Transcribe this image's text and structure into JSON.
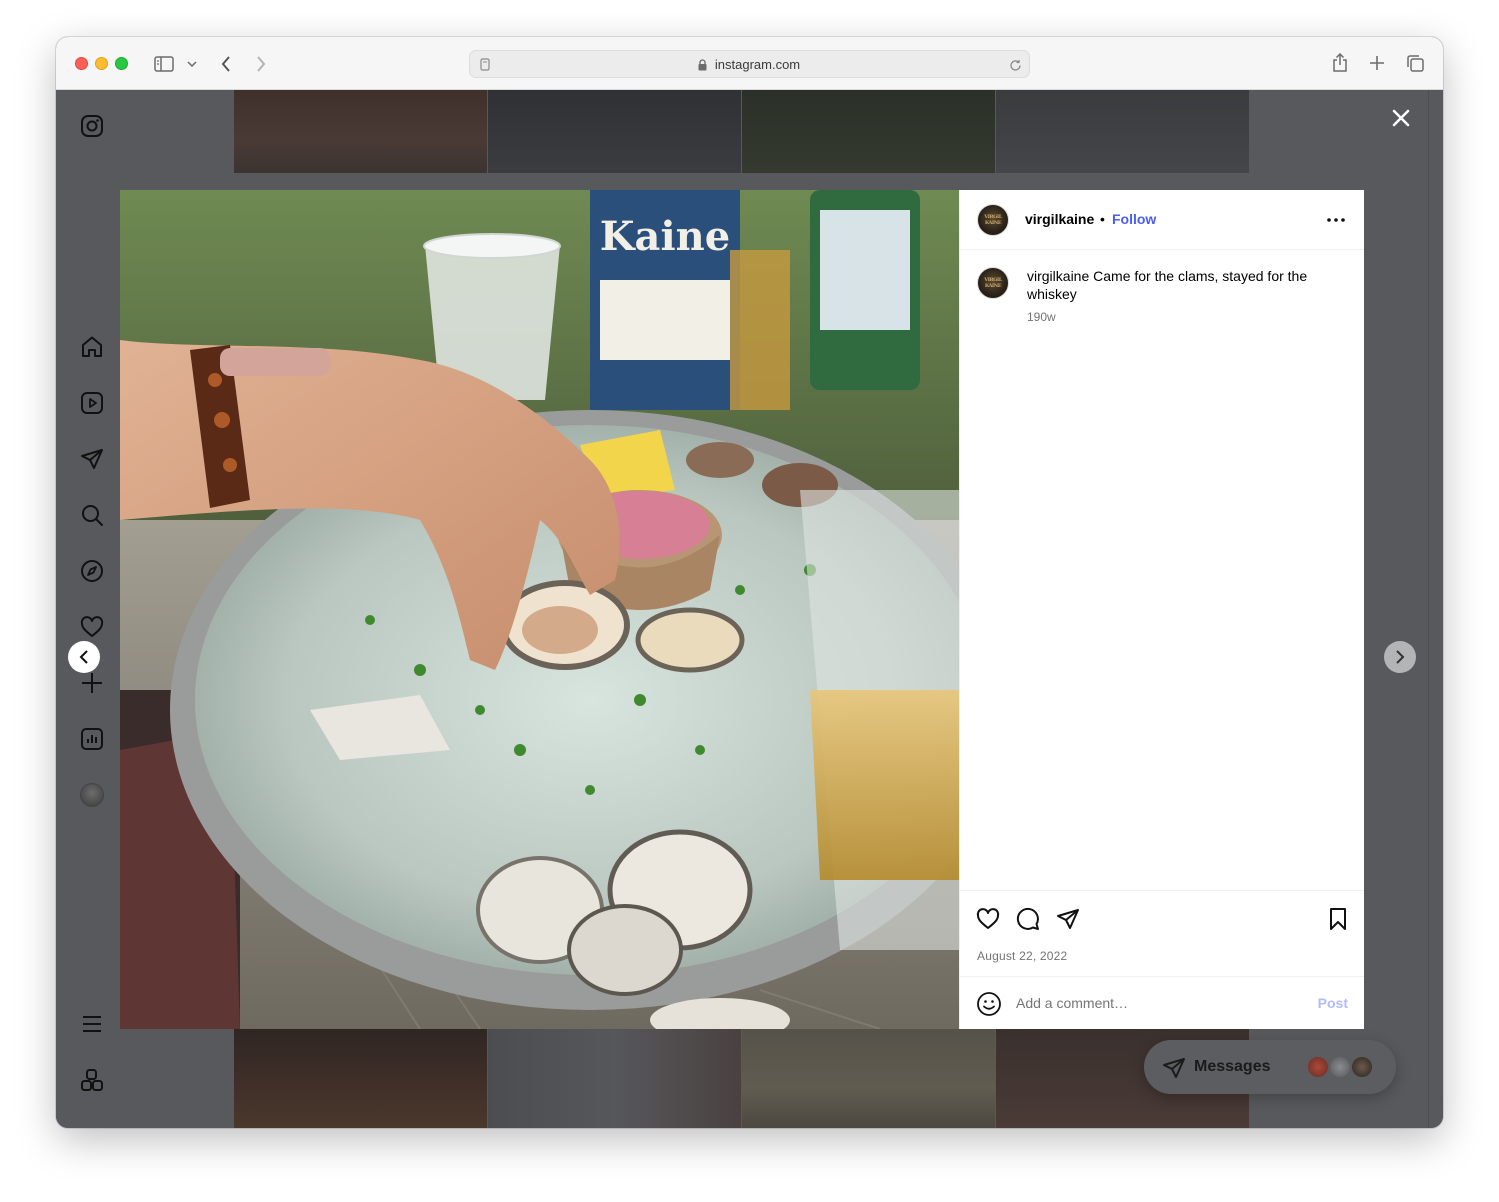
{
  "browser": {
    "url": "instagram.com"
  },
  "post": {
    "username": "virgilkaine",
    "separator": "•",
    "follow_label": "Follow",
    "caption_username": "virgilkaine",
    "caption_text": "Came for the clams, stayed for the whiskey",
    "age": "190w",
    "date": "August 22, 2022",
    "avatar_monogram": "VIRGIL KAINE"
  },
  "comment": {
    "placeholder": "Add a comment…",
    "post_label": "Post"
  },
  "messages": {
    "label": "Messages"
  },
  "icons": {
    "app_logo": "instagram-icon",
    "home": "home-icon",
    "reels": "reels-icon",
    "direct": "paper-plane-icon",
    "search": "search-icon",
    "explore": "compass-icon",
    "notifications": "heart-icon",
    "create": "plus-icon",
    "insights": "bar-chart-icon",
    "more_menu": "hamburger-icon",
    "threads": "apps-icon"
  },
  "colors": {
    "link_blue": "#4a5df9",
    "post_disabled": "#b2bcfa",
    "overlay": "#58595c"
  }
}
